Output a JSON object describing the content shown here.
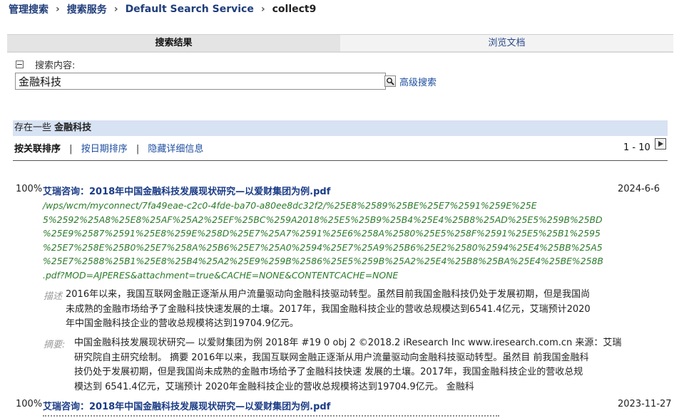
{
  "breadcrumb": {
    "items": [
      "管理搜索",
      "搜索服务",
      "Default Search Service"
    ],
    "current": "collect9"
  },
  "tabs": {
    "results": "搜索结果",
    "browse": "浏览文档"
  },
  "search": {
    "label": "搜索内容:",
    "value": "金融科技",
    "advanced": "高级搜索"
  },
  "results_bar": {
    "prefix": "存在一些",
    "term": "金融科技"
  },
  "sort": {
    "relevance": "按关联排序",
    "by_date": "按日期排序",
    "hide_details": "隐藏详细信息"
  },
  "pager": {
    "range": "1 - 10"
  },
  "results": [
    {
      "score": "100%",
      "title": "艾瑞咨询：2018年中国金融科技发展现状研究—以爱财集团为例.pdf",
      "date": "2024-6-6",
      "url_lines": [
        "/wps/wcm/myconnect/7fa49eae-c2c0-4fde-ba70-a80ee8dc32f2/%25E8%2589%25BE%25E7%2591%259E%25E",
        "5%2592%25A8%25E8%25AF%25A2%25EF%25BC%259A2018%25E5%25B9%25B4%25E4%25B8%25AD%25E5%259B%25BD",
        "%25E9%2587%2591%25E8%259E%258D%25E7%25A7%2591%25E6%258A%2580%25E5%258F%2591%25E5%25B1%2595",
        "%25E7%258E%25B0%25E7%258A%25B6%25E7%25A0%2594%25E7%25A9%25B6%25E2%2580%2594%25E4%25BB%25A5",
        "%25E7%2588%25B1%25E8%25B4%25A2%25E9%259B%2586%25E5%259B%25A2%25E4%25B8%25BA%25E4%25BE%258B",
        ".pdf?MOD=AJPERES&attachment=true&CACHE=NONE&CONTENTCACHE=NONE"
      ],
      "desc_label": "描述",
      "desc_lines": [
        "2016年以来，我国互联网金融正逐渐从用户流量驱动向金融科技驱动转型。虽然目前我国金融科技仍处于发展初期，但是我国尚",
        "未成熟的金融市场给予了金融科技快速发展的土壤。2017年，我国金融科技企业的营收总规模达到6541.4亿元，艾瑞预计2020",
        "年中国金融科技企业的营收总规模将达到19704.9亿元。"
      ],
      "abs_label": "摘要:",
      "abs_lines": [
        "中国金融科技发展现状研究— 以爱财集团为例 2018年 #19 0 obj 2 ©2018.2 iResearch Inc www.iresearch.com.cn 来源：艾瑞",
        "研究院自主研究绘制。 摘要 2016年以来，我国互联网金融正逐渐从用户流量驱动向金融科技驱动转型。虽然目 前我国金融科",
        "技仍处于发展初期，但是我国尚未成熟的金融市场给予了金融科技快速 发展的土壤。2017年，我国金融科技企业的营收总规",
        "模达到 6541.4亿元，艾瑞预计 2020年金融科技企业的营收总规模将达到19704.9亿元。 金融科"
      ]
    },
    {
      "score": "100%",
      "title": "艾瑞咨询：2018年中国金融科技发展现状研究—以爱财集团为例.pdf",
      "date": "2023-11-27"
    }
  ],
  "colors": {
    "link": "#1a3b86",
    "url_green": "#2a7a2a",
    "bar_blue": "#d7e2f3",
    "label_gray": "#9a9a9a"
  }
}
